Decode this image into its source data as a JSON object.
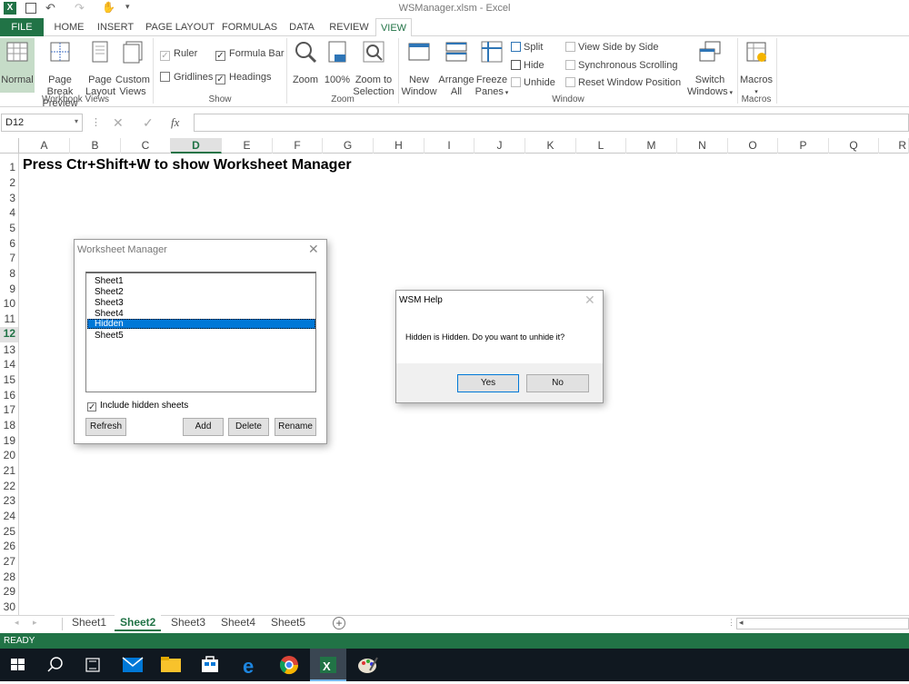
{
  "window": {
    "title": "WSManager.xlsm - Excel"
  },
  "ribbon_tabs": [
    "FILE",
    "HOME",
    "INSERT",
    "PAGE LAYOUT",
    "FORMULAS",
    "DATA",
    "REVIEW",
    "VIEW"
  ],
  "workbook_views": {
    "normal": "Normal",
    "page_break_1": "Page Break",
    "page_break_2": "Preview",
    "page_layout_1": "Page",
    "page_layout_2": "Layout",
    "custom_views_1": "Custom",
    "custom_views_2": "Views",
    "label": "Workbook Views"
  },
  "show": {
    "ruler": "Ruler",
    "formula_bar": "Formula Bar",
    "gridlines": "Gridlines",
    "headings": "Headings",
    "label": "Show"
  },
  "zoom": {
    "zoom": "Zoom",
    "zoom100": "100%",
    "zoom_sel_1": "Zoom to",
    "zoom_sel_2": "Selection",
    "label": "Zoom"
  },
  "window_group": {
    "new_window_1": "New",
    "new_window_2": "Window",
    "arrange_1": "Arrange",
    "arrange_2": "All",
    "freeze_1": "Freeze",
    "freeze_2": "Panes",
    "split": "Split",
    "hide": "Hide",
    "unhide": "Unhide",
    "side_by_side": "View Side by Side",
    "sync_scroll": "Synchronous Scrolling",
    "reset_pos": "Reset Window Position",
    "switch_1": "Switch",
    "switch_2": "Windows",
    "label": "Window"
  },
  "macros": {
    "macros": "Macros",
    "label": "Macros"
  },
  "formula_bar": {
    "name_box": "D12",
    "fx": "fx"
  },
  "columns": [
    "A",
    "B",
    "C",
    "D",
    "E",
    "F",
    "G",
    "H",
    "I",
    "J",
    "K",
    "L",
    "M",
    "N",
    "O",
    "P",
    "Q",
    "R"
  ],
  "rows": [
    "1",
    "2",
    "3",
    "4",
    "5",
    "6",
    "7",
    "8",
    "9",
    "10",
    "11",
    "12",
    "13",
    "14",
    "15",
    "16",
    "17",
    "18",
    "19",
    "20",
    "21",
    "22",
    "23",
    "24",
    "25",
    "26",
    "27",
    "28",
    "29",
    "30"
  ],
  "cell_a1": "Press Ctr+Shift+W to show Worksheet Manager",
  "wsm": {
    "title": "Worksheet Manager",
    "sheets": [
      "Sheet1",
      "Sheet2",
      "Sheet3",
      "Sheet4",
      "Hidden",
      "Sheet5"
    ],
    "include_hidden": "Include hidden sheets",
    "refresh": "Refresh",
    "add": "Add",
    "delete": "Delete",
    "rename": "Rename"
  },
  "help": {
    "title": "WSM Help",
    "message": "Hidden is Hidden. Do you want to unhide it?",
    "yes": "Yes",
    "no": "No"
  },
  "sheet_tabs": [
    "Sheet1",
    "Sheet2",
    "Sheet3",
    "Sheet4",
    "Sheet5"
  ],
  "status": "READY",
  "colors": {
    "accent": "#217346",
    "selection": "#0078d7"
  }
}
